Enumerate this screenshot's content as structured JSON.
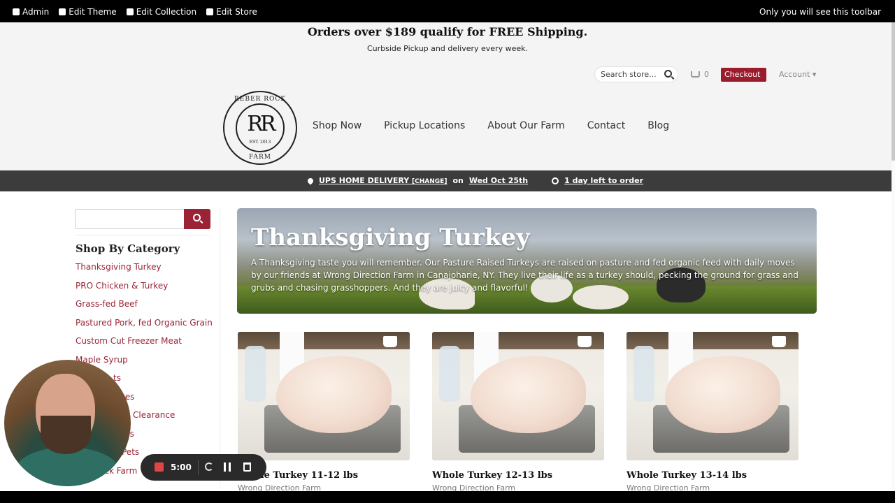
{
  "admin_bar": {
    "items": [
      "Admin",
      "Edit Theme",
      "Edit Collection",
      "Edit Store"
    ],
    "notice": "Only you will see this toolbar"
  },
  "shipping": {
    "headline": "Orders over $189 qualify for FREE Shipping.",
    "subline": "Curbside Pickup and delivery every week."
  },
  "header": {
    "search_placeholder": "Search store...",
    "cart_count": "0",
    "checkout_label": "Checkout ›",
    "account_label": "Account ▾"
  },
  "logo": {
    "top_text": "REBER ROCK",
    "monogram": "RR",
    "est": "EST. 2013",
    "bottom_text": "FARM"
  },
  "nav": [
    "Shop Now",
    "Pickup Locations",
    "About Our Farm",
    "Contact",
    "Blog"
  ],
  "delivery": {
    "method": "UPS HOME DELIVERY",
    "change": "[CHANGE]",
    "on": "on",
    "date": "Wed Oct 25th",
    "left": "1 day left to order"
  },
  "sidebar": {
    "title": "Shop By Category",
    "categories": [
      "Thanksgiving Turkey",
      "PRO Chicken & Turkey",
      "Grass-fed Beef",
      "Pastured Pork, fed Organic Grain",
      "Custom Cut Freezer Meat",
      "Maple Syrup",
      "ts",
      "xes",
      "Clearance",
      "gs",
      "Pets",
      "ock Farm"
    ]
  },
  "hero": {
    "title": "Thanksgiving Turkey",
    "description": "A Thanksgiving taste you will remember. Our Pasture Raised Turkeys are raised on pasture and fed organic feed with daily moves by our friends at Wrong Direction Farm in Canajoharie, NY. They live their life as a turkey should, pecking the ground for grass and grubs and chasing grasshoppers. And they are juicy and flavorful!"
  },
  "products": [
    {
      "name": "Whole Turkey 11-12 lbs",
      "farm": "Wrong Direction Farm"
    },
    {
      "name": "Whole Turkey 12-13 lbs",
      "farm": "Wrong Direction Farm"
    },
    {
      "name": "Whole Turkey 13-14 lbs",
      "farm": "Wrong Direction Farm"
    }
  ],
  "recorder": {
    "time": "5:00"
  },
  "colors": {
    "brand": "#9b2335",
    "delivery_bar": "#3c3c3c"
  }
}
